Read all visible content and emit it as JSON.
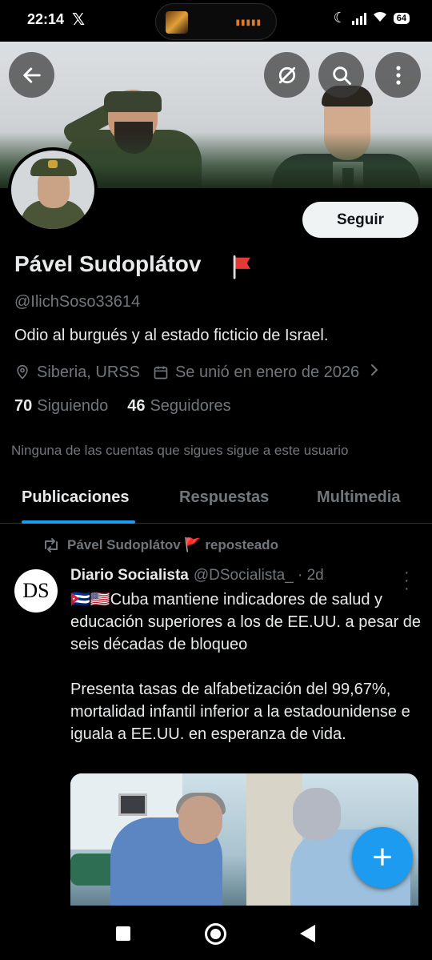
{
  "status_bar": {
    "time": "22:14",
    "x_logo": "𝕏",
    "battery": "64"
  },
  "header": {
    "back_icon": "arrow-left-icon",
    "unfollow_icon": "no-eye-icon",
    "search_icon": "search-icon",
    "more_icon": "more-vertical-icon"
  },
  "profile": {
    "name": "Pável Sudoplátov",
    "name_emoji": "🚩",
    "handle": "@IlichSoso33614",
    "bio": "Odio al burgués y al estado ficticio de Israel.",
    "location": "Siberia, URSS",
    "joined": "Se unió en enero de 2026",
    "following_count": "70",
    "following_label": "Siguiendo",
    "followers_count": "46",
    "followers_label": "Seguidores",
    "mutuals_note": "Ninguna de las cuentas que sigues sigue a este usuario",
    "follow_button": "Seguir"
  },
  "tabs": [
    "Publicaciones",
    "Respuestas",
    "Multimedia"
  ],
  "post": {
    "repost_label": "Pável Sudoplátov 🚩 reposteado",
    "avatar_text": "DS",
    "author": "Diario Socialista",
    "handle_time": "@DSocialista_ · 2d",
    "paragraph1": "🇨🇺🇺🇸Cuba mantiene indicadores de salud y educación superiores a los de EE.UU. a pesar de seis décadas de bloqueo",
    "paragraph2": "Presenta tasas de alfabetización del 99,67%, mortalidad infantil inferior a la estadounidense e iguala a EE.UU. en esperanza de vida."
  },
  "fab": {
    "label": "+"
  },
  "colors": {
    "accent": "#1d9bf0",
    "muted": "#71767b",
    "text": "#e7e9ea",
    "background": "#000000"
  }
}
